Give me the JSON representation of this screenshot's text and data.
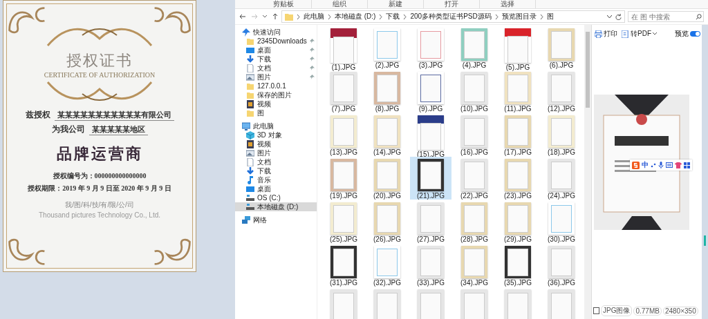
{
  "certificate": {
    "title": "授权证书",
    "subtitle": "CERTIFICATE OF AUTHORIZATION",
    "grant_label": "兹授权",
    "grantee": "某某某某某某某某某某某有限公司",
    "region_label": "为我公司",
    "region": "某某某某某地区",
    "role": "品牌运营商",
    "number_line": "授权编号为：000000000000000",
    "period_line": "授权期限：2019 年 9 月 9 日至 2020 年 9 月 9 日",
    "issuer": "我/图/科/技/有/限/公/司",
    "issuer_en": "Thousand pictures Technology Co., Ltd."
  },
  "explorer": {
    "ribbon_groups": [
      "剪贴板",
      "组织",
      "新建",
      "打开",
      "选择"
    ],
    "breadcrumb": [
      "此电脑",
      "本地磁盘 (D:)",
      "下载",
      "200多种类型证书PSD源码",
      "预览图目录",
      "图"
    ],
    "search": {
      "placeholder": "在 图 中搜索"
    },
    "sidebar": [
      {
        "label": "快速访问",
        "kind": "star",
        "children": [
          {
            "label": "2345Downloads",
            "kind": "folder",
            "pinned": true,
            "selected": false
          },
          {
            "label": "桌面",
            "kind": "desktop",
            "pinned": true,
            "selected": false
          },
          {
            "label": "下载",
            "kind": "download",
            "pinned": true,
            "selected": false
          },
          {
            "label": "文档",
            "kind": "document",
            "pinned": true,
            "selected": false
          },
          {
            "label": "图片",
            "kind": "picture",
            "pinned": true,
            "selected": false
          },
          {
            "label": "127.0.0.1",
            "kind": "folder",
            "pinned": false,
            "selected": false
          },
          {
            "label": "保存的图片",
            "kind": "folder",
            "pinned": false,
            "selected": false
          },
          {
            "label": "视频",
            "kind": "video",
            "pinned": false,
            "selected": false
          },
          {
            "label": "图",
            "kind": "folder",
            "pinned": false,
            "selected": false
          }
        ]
      },
      {
        "label": "此电脑",
        "kind": "computer",
        "children": [
          {
            "label": "3D 对象",
            "kind": "cube",
            "pinned": false,
            "selected": false
          },
          {
            "label": "视频",
            "kind": "video",
            "pinned": false,
            "selected": false
          },
          {
            "label": "图片",
            "kind": "picture",
            "pinned": false,
            "selected": false
          },
          {
            "label": "文档",
            "kind": "document",
            "pinned": false,
            "selected": false
          },
          {
            "label": "下载",
            "kind": "download",
            "pinned": false,
            "selected": false
          },
          {
            "label": "音乐",
            "kind": "music",
            "pinned": false,
            "selected": false
          },
          {
            "label": "桌面",
            "kind": "desktop",
            "pinned": false,
            "selected": false
          },
          {
            "label": "OS (C:)",
            "kind": "drive",
            "pinned": false,
            "selected": false
          },
          {
            "label": "本地磁盘 (D:)",
            "kind": "drive",
            "pinned": false,
            "selected": true
          }
        ]
      },
      {
        "label": "网络",
        "kind": "network"
      }
    ],
    "files": [
      {
        "label": "(1).JPG",
        "selected": false
      },
      {
        "label": "(2).JPG",
        "selected": false
      },
      {
        "label": "(3).JPG",
        "selected": false
      },
      {
        "label": "(4).JPG",
        "selected": false
      },
      {
        "label": "(5).JPG",
        "selected": false
      },
      {
        "label": "(6).JPG",
        "selected": false
      },
      {
        "label": "(7).JPG",
        "selected": false
      },
      {
        "label": "(8).JPG",
        "selected": false
      },
      {
        "label": "(9).JPG",
        "selected": false
      },
      {
        "label": "(10).JPG",
        "selected": false
      },
      {
        "label": "(11).JPG",
        "selected": false
      },
      {
        "label": "(12).JPG",
        "selected": false
      },
      {
        "label": "(13).JPG",
        "selected": false
      },
      {
        "label": "(14).JPG",
        "selected": false
      },
      {
        "label": "(15).JPG",
        "selected": false
      },
      {
        "label": "(16).JPG",
        "selected": false
      },
      {
        "label": "(17).JPG",
        "selected": false
      },
      {
        "label": "(18).JPG",
        "selected": false
      },
      {
        "label": "(19).JPG",
        "selected": false
      },
      {
        "label": "(20).JPG",
        "selected": false
      },
      {
        "label": "(21).JPG",
        "selected": true
      },
      {
        "label": "(22).JPG",
        "selected": false
      },
      {
        "label": "(23).JPG",
        "selected": false
      },
      {
        "label": "(24).JPG",
        "selected": false
      },
      {
        "label": "(25).JPG",
        "selected": false
      },
      {
        "label": "(26).JPG",
        "selected": false
      },
      {
        "label": "(27).JPG",
        "selected": false
      },
      {
        "label": "(28).JPG",
        "selected": false
      },
      {
        "label": "(29).JPG",
        "selected": false
      },
      {
        "label": "(30).JPG",
        "selected": false
      },
      {
        "label": "(31).JPG",
        "selected": false
      },
      {
        "label": "(32).JPG",
        "selected": false
      },
      {
        "label": "(33).JPG",
        "selected": false
      },
      {
        "label": "(34).JPG",
        "selected": false
      },
      {
        "label": "(35).JPG",
        "selected": false
      },
      {
        "label": "(36).JPG",
        "selected": false
      },
      {
        "selected": false
      },
      {
        "selected": false
      },
      {
        "selected": false
      },
      {
        "selected": false
      },
      {
        "selected": false
      },
      {
        "selected": false
      }
    ],
    "preview": {
      "actions": [
        {
          "label": "打印",
          "kind": "print"
        },
        {
          "label": "转PDF",
          "kind": "pdf"
        }
      ],
      "toggle": {
        "label": "预览",
        "on": true
      },
      "tags": [
        "JPG图像",
        "0.77MB",
        "2480×350"
      ]
    },
    "ime_toolbar": {
      "mode": "中"
    }
  }
}
